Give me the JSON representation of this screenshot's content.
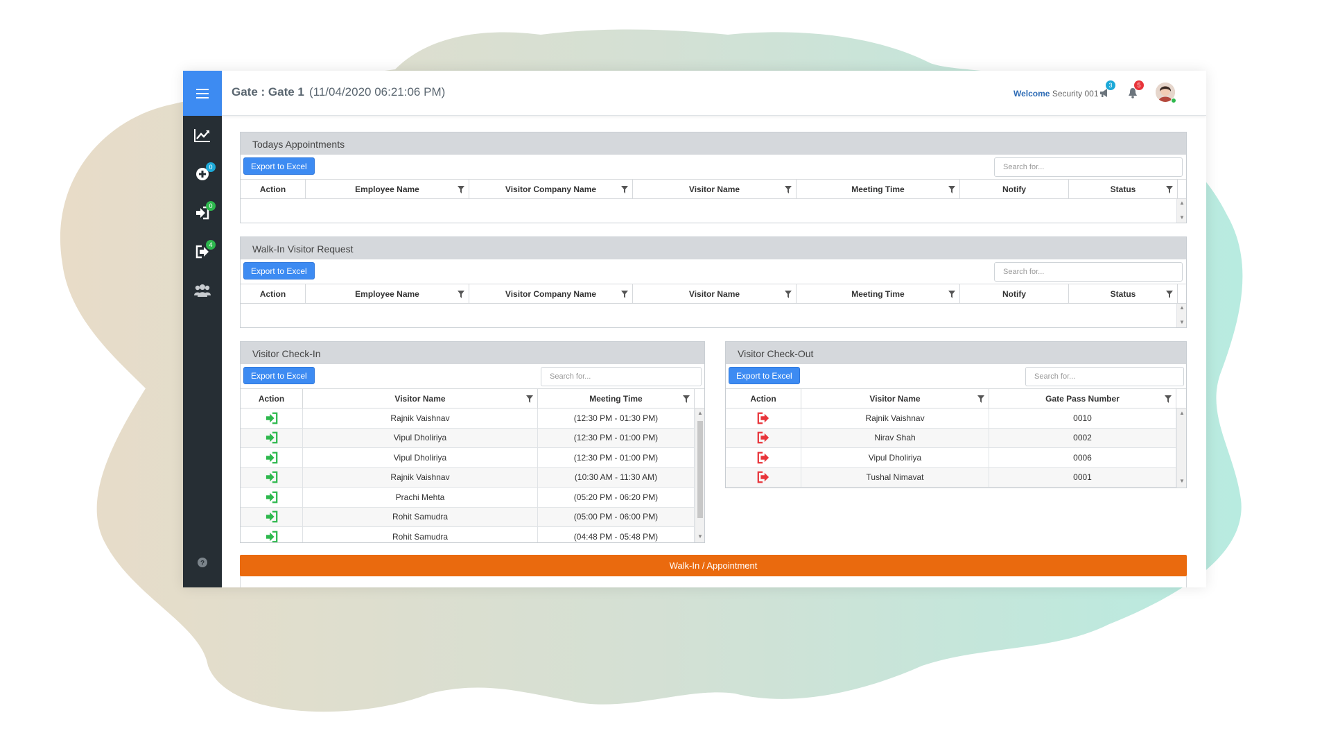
{
  "header": {
    "gate_label": "Gate : Gate 1",
    "datetime": "(11/04/2020 06:21:06 PM)",
    "welcome_prefix": "Welcome",
    "welcome_user": "Security 001",
    "notification_count_a": "3",
    "notification_count_b": "5"
  },
  "sidebar": {
    "menu_icon": "hamburger-icon",
    "items": [
      {
        "icon": "chart-line-icon",
        "badge": ""
      },
      {
        "icon": "plus-circle-icon",
        "badge": "0"
      },
      {
        "icon": "sign-in-icon",
        "badge": "0"
      },
      {
        "icon": "sign-out-icon",
        "badge": "4"
      },
      {
        "icon": "users-icon",
        "badge": ""
      },
      {
        "icon": "help-icon",
        "badge": ""
      }
    ]
  },
  "todays_appointments": {
    "title": "Todays Appointments",
    "export_label": "Export to Excel",
    "search_placeholder": "Search for...",
    "columns": [
      "Action",
      "Employee Name",
      "Visitor Company Name",
      "Visitor Name",
      "Meeting Time",
      "Notify",
      "Status"
    ]
  },
  "walkin_request": {
    "title": "Walk-In Visitor Request",
    "export_label": "Export to Excel",
    "search_placeholder": "Search for...",
    "columns": [
      "Action",
      "Employee Name",
      "Visitor Company Name",
      "Visitor Name",
      "Meeting Time",
      "Notify",
      "Status"
    ]
  },
  "checkin": {
    "title": "Visitor Check-In",
    "export_label": "Export to Excel",
    "search_placeholder": "Search for...",
    "columns": [
      "Action",
      "Visitor Name",
      "Meeting Time"
    ],
    "rows": [
      {
        "name": "Rajnik Vaishnav",
        "time": "(12:30 PM - 01:30 PM)"
      },
      {
        "name": "Vipul Dholiriya",
        "time": "(12:30 PM - 01:00 PM)"
      },
      {
        "name": "Vipul Dholiriya",
        "time": "(12:30 PM - 01:00 PM)"
      },
      {
        "name": "Rajnik Vaishnav",
        "time": "(10:30 AM - 11:30 AM)"
      },
      {
        "name": "Prachi Mehta",
        "time": "(05:20 PM - 06:20 PM)"
      },
      {
        "name": "Rohit Samudra",
        "time": "(05:00 PM - 06:00 PM)"
      },
      {
        "name": "Rohit Samudra",
        "time": "(04:48 PM - 05:48 PM)"
      }
    ]
  },
  "checkout": {
    "title": "Visitor Check-Out",
    "export_label": "Export to Excel",
    "search_placeholder": "Search for...",
    "columns": [
      "Action",
      "Visitor Name",
      "Gate Pass Number"
    ],
    "rows": [
      {
        "name": "Rajnik Vaishnav",
        "pass": "0010"
      },
      {
        "name": "Nirav Shah",
        "pass": "0002"
      },
      {
        "name": "Vipul Dholiriya",
        "pass": "0006"
      },
      {
        "name": "Tushal Nimavat",
        "pass": "0001"
      }
    ]
  },
  "walkin_bar": {
    "label": "Walk-In /  Appointment"
  },
  "colors": {
    "primary": "#3d8bf2",
    "sidebar": "#262e34",
    "orange": "#ea6a0e",
    "checkin_icon": "#2db84d",
    "checkout_icon": "#e8343a"
  }
}
